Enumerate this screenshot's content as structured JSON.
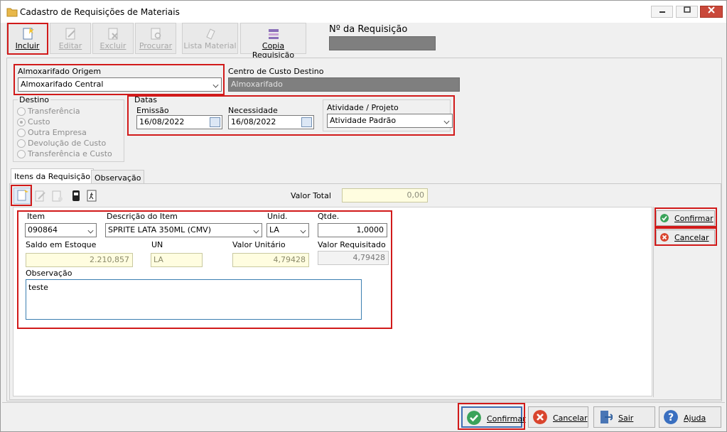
{
  "window": {
    "title": "Cadastro de Requisições de Materiais"
  },
  "toolbar": {
    "incluir": "Incluir",
    "editar": "Editar",
    "excluir": "Excluir",
    "procurar": "Procurar",
    "lista_material": "Lista Material",
    "copia_requisicao": "Copia Requisição",
    "n_requisicao_label": "Nº da Requisição",
    "n_requisicao_value": ""
  },
  "origem": {
    "label": "Almoxarifado Origem",
    "value": "Almoxarifado Central"
  },
  "centro_custo": {
    "label": "Centro de Custo Destino",
    "value": "Almoxarifado"
  },
  "destino": {
    "label": "Destino",
    "options": [
      "Transferência",
      "Custo",
      "Outra Empresa",
      "Devolução de Custo",
      "Transferência e Custo"
    ],
    "selected": "Custo"
  },
  "datas": {
    "label": "Datas",
    "emissao_label": "Emissão",
    "emissao_value": "16/08/2022",
    "necessidade_label": "Necessidade",
    "necessidade_value": "16/08/2022"
  },
  "atividade": {
    "label": "Atividade / Projeto",
    "value": "Atividade Padrão"
  },
  "tabs": {
    "itens": "Itens da Requisição",
    "observacao": "Observação"
  },
  "valor_total": {
    "label": "Valor Total",
    "value": "0,00"
  },
  "item": {
    "item_label": "Item",
    "item_value": "090864",
    "descricao_label": "Descrição do Item",
    "descricao_value": "SPRITE LATA 350ML (CMV)",
    "unid_label": "Unid.",
    "unid_value": "LA",
    "qtde_label": "Qtde.",
    "qtde_value": "1,0000",
    "saldo_label": "Saldo em Estoque",
    "saldo_value": "2.210,857",
    "un_label": "UN",
    "un_value": "LA",
    "valor_unit_label": "Valor Unitário",
    "valor_unit_value": "4,79428",
    "valor_req_label": "Valor Requisitado",
    "valor_req_value": "4,79428",
    "obs_label": "Observação",
    "obs_value": "teste"
  },
  "side_buttons": {
    "confirmar": "Confirmar",
    "cancelar": "Cancelar"
  },
  "bottom_buttons": {
    "confirmar": "Confirmar",
    "cancelar": "Cancelar",
    "sair": "Sair",
    "ajuda": "Ajuda"
  },
  "colors": {
    "highlight": "#d11a1a",
    "readonly_fill": "#fffde0",
    "disabled_fill": "#7f7f7f"
  }
}
